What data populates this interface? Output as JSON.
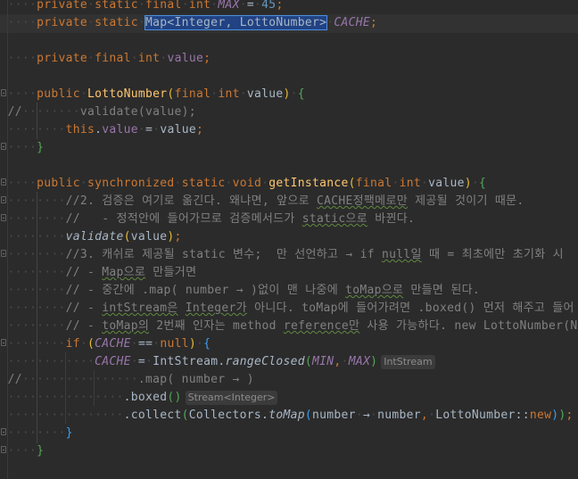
{
  "editor": {
    "colors": {
      "background": "#2b2b2b",
      "keyword": "#cc7832",
      "field": "#9876aa",
      "method": "#ffc66d",
      "number": "#6897bb",
      "comment": "#808080",
      "selection": "#214283"
    },
    "lines": [
      [
        [
          "    ",
          "ws"
        ],
        [
          "private",
          "kw"
        ],
        [
          " ",
          "ws"
        ],
        [
          "static",
          "kw"
        ],
        [
          " ",
          "ws"
        ],
        [
          "final",
          "kw"
        ],
        [
          " ",
          "ws"
        ],
        [
          "int",
          "kw"
        ],
        [
          " ",
          "ws"
        ],
        [
          "MAX",
          "fldi"
        ],
        [
          " ",
          "ws"
        ],
        [
          "=",
          ""
        ],
        [
          " ",
          "ws"
        ],
        [
          "45",
          "num"
        ],
        [
          ";",
          "kw"
        ]
      ],
      [
        [
          "    ",
          "ws"
        ],
        [
          "private",
          "kw"
        ],
        [
          " ",
          "ws"
        ],
        [
          "static",
          "kw"
        ],
        [
          " ",
          "ws"
        ],
        [
          "Map<Integer, LottoNumber>",
          "sel"
        ],
        [
          " ",
          "ws"
        ],
        [
          "CACHE",
          "fldi"
        ],
        [
          ";",
          "kw"
        ]
      ],
      [],
      [
        [
          "    ",
          "ws"
        ],
        [
          "private",
          "kw"
        ],
        [
          " ",
          "ws"
        ],
        [
          "final",
          "kw"
        ],
        [
          " ",
          "ws"
        ],
        [
          "int",
          "kw"
        ],
        [
          " ",
          "ws"
        ],
        [
          "value",
          "fld"
        ],
        [
          ";",
          "kw"
        ]
      ],
      [],
      [
        [
          "    ",
          "ws"
        ],
        [
          "public",
          "kw"
        ],
        [
          " ",
          "ws"
        ],
        [
          "LottoNumber",
          "mth"
        ],
        [
          "(",
          "p1"
        ],
        [
          "final",
          "kw"
        ],
        [
          " ",
          "ws"
        ],
        [
          "int",
          "kw"
        ],
        [
          " ",
          "ws"
        ],
        [
          "value",
          ""
        ],
        [
          ")",
          "p1"
        ],
        [
          " ",
          "ws"
        ],
        [
          "{",
          "p2"
        ]
      ],
      [
        [
          "//",
          "cmt"
        ],
        [
          "        ",
          "ws"
        ],
        [
          "validate(value);",
          "cmt"
        ]
      ],
      [
        [
          "        ",
          "ws"
        ],
        [
          "this",
          "kw"
        ],
        [
          ".",
          ""
        ],
        [
          "value",
          "fld"
        ],
        [
          " ",
          "ws"
        ],
        [
          "=",
          ""
        ],
        [
          " ",
          "ws"
        ],
        [
          "value",
          ""
        ],
        [
          ";",
          "kw"
        ]
      ],
      [
        [
          "    ",
          "ws"
        ],
        [
          "}",
          "p2"
        ]
      ],
      [],
      [
        [
          "    ",
          "ws"
        ],
        [
          "public",
          "kw"
        ],
        [
          " ",
          "ws"
        ],
        [
          "synchronized",
          "kw"
        ],
        [
          " ",
          "ws"
        ],
        [
          "static",
          "kw"
        ],
        [
          " ",
          "ws"
        ],
        [
          "void",
          "kw"
        ],
        [
          " ",
          "ws"
        ],
        [
          "getInstance",
          "mth"
        ],
        [
          "(",
          "p1"
        ],
        [
          "final",
          "kw"
        ],
        [
          " ",
          "ws"
        ],
        [
          "int",
          "kw"
        ],
        [
          " ",
          "ws"
        ],
        [
          "value",
          ""
        ],
        [
          ")",
          "p1"
        ],
        [
          " ",
          "ws"
        ],
        [
          "{",
          "p2"
        ]
      ],
      [
        [
          "        ",
          "ws"
        ],
        [
          "//2. 검증은 여기로 옮긴다. 왜냐면, 앞으로 ",
          "cmt"
        ],
        [
          "CACHE정팩메로만",
          "cmtu"
        ],
        [
          " 제공될 것이기 때문.",
          "cmt"
        ]
      ],
      [
        [
          "        ",
          "ws"
        ],
        [
          "//   - 정적안에 들어가므로 검증메서드가 ",
          "cmt"
        ],
        [
          "static으로",
          "cmtu"
        ],
        [
          " 바뀐다.",
          "cmt"
        ]
      ],
      [
        [
          "        ",
          "ws"
        ],
        [
          "validate",
          "it"
        ],
        [
          "(",
          "p1"
        ],
        [
          "value",
          ""
        ],
        [
          ")",
          "p1"
        ],
        [
          ";",
          "kw"
        ]
      ],
      [
        [
          "        ",
          "ws"
        ],
        [
          "//3. 캐쉬로 제공될 static 변수;  만 선언하고 → if ",
          "cmt"
        ],
        [
          "null일",
          "cmtu"
        ],
        [
          " 때 = 최초에만 초기화 시",
          "cmt"
        ]
      ],
      [
        [
          "        ",
          "ws"
        ],
        [
          "// - ",
          "cmt"
        ],
        [
          "Map으로",
          "cmtu"
        ],
        [
          " 만들거면",
          "cmt"
        ]
      ],
      [
        [
          "        ",
          "ws"
        ],
        [
          "// - 중간에 .map( number → )없이 맨 나중에 ",
          "cmt"
        ],
        [
          "toMap으로",
          "cmtu"
        ],
        [
          " 만들면 된다.",
          "cmt"
        ]
      ],
      [
        [
          "        ",
          "ws"
        ],
        [
          "// - ",
          "cmt"
        ],
        [
          "intStream은",
          "cmtu"
        ],
        [
          " ",
          "cmt"
        ],
        [
          "Integer가",
          "cmtu"
        ],
        [
          " 아니다. toMap에 들어가려면 .boxed() 먼저 해주고 들어",
          "cmt"
        ]
      ],
      [
        [
          "        ",
          "ws"
        ],
        [
          "// - ",
          "cmt"
        ],
        [
          "toMap의",
          "cmtu"
        ],
        [
          " 2번째 인자는 method ",
          "cmt"
        ],
        [
          "reference만",
          "cmtu"
        ],
        [
          " 사용 가능하다. new LottoNumber(N",
          "cmt"
        ]
      ],
      [
        [
          "        ",
          "ws"
        ],
        [
          "if",
          "kw"
        ],
        [
          " ",
          "ws"
        ],
        [
          "(",
          "p1"
        ],
        [
          "CACHE",
          "fldi"
        ],
        [
          " ",
          "ws"
        ],
        [
          "==",
          ""
        ],
        [
          " ",
          "ws"
        ],
        [
          "null",
          "kw"
        ],
        [
          ")",
          "p1"
        ],
        [
          " ",
          "ws"
        ],
        [
          "{",
          "p3"
        ]
      ],
      [
        [
          "            ",
          "ws"
        ],
        [
          "CACHE",
          "fldi"
        ],
        [
          " ",
          "ws"
        ],
        [
          "=",
          ""
        ],
        [
          " ",
          "ws"
        ],
        [
          "IntStream.",
          ""
        ],
        [
          "rangeClosed",
          "it"
        ],
        [
          "(",
          "p2"
        ],
        [
          "MIN",
          "fldi"
        ],
        [
          ",",
          "kw"
        ],
        [
          " ",
          "ws"
        ],
        [
          "MAX",
          "fldi"
        ],
        [
          ")",
          "p2"
        ],
        [
          "IntStream",
          "hint"
        ]
      ],
      [
        [
          "//",
          "cmt"
        ],
        [
          "                ",
          "ws"
        ],
        [
          ".map( number → )",
          "cmt"
        ]
      ],
      [
        [
          "                ",
          "ws"
        ],
        [
          ".boxed",
          ""
        ],
        [
          "()",
          "p2"
        ],
        [
          "Stream<Integer>",
          "hint"
        ]
      ],
      [
        [
          "                ",
          "ws"
        ],
        [
          ".collect",
          ""
        ],
        [
          "(",
          "p2"
        ],
        [
          "Collectors.",
          ""
        ],
        [
          "toMap",
          "it"
        ],
        [
          "(",
          "p3"
        ],
        [
          "number",
          ""
        ],
        [
          " ",
          "ws"
        ],
        [
          "→",
          ""
        ],
        [
          " ",
          "ws"
        ],
        [
          "number",
          ""
        ],
        [
          ",",
          "kw"
        ],
        [
          " ",
          "ws"
        ],
        [
          "LottoNumber::",
          ""
        ],
        [
          "new",
          "kw"
        ],
        [
          ")",
          "p3"
        ],
        [
          ")",
          "p2"
        ],
        [
          ";",
          "kw"
        ]
      ],
      [
        [
          "        ",
          "ws"
        ],
        [
          "}",
          "p3"
        ]
      ],
      [
        [
          "    ",
          "ws"
        ],
        [
          "}",
          "p2"
        ]
      ]
    ]
  }
}
